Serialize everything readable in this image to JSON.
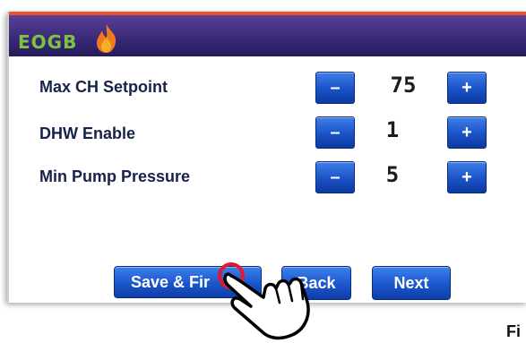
{
  "header": {
    "logo_text": "EOGB",
    "accent_color": "#e8552d",
    "bar_color": "#3a2a78",
    "logo_color": "#7fc241"
  },
  "settings": [
    {
      "label": "Max CH Setpoint",
      "value": "75",
      "minus": "–",
      "plus": "+"
    },
    {
      "label": "DHW Enable",
      "value": "1",
      "minus": "–",
      "plus": "+"
    },
    {
      "label": "Min Pump Pressure",
      "value": "5",
      "minus": "–",
      "plus": "+"
    }
  ],
  "footer": {
    "save_label": "Save & Fir",
    "back_label": "Back",
    "next_label": "Next"
  },
  "caption": {
    "text": "Fi"
  },
  "cursor": {
    "icon": "hand-pointer-icon"
  },
  "button_color": "#1a52c6"
}
